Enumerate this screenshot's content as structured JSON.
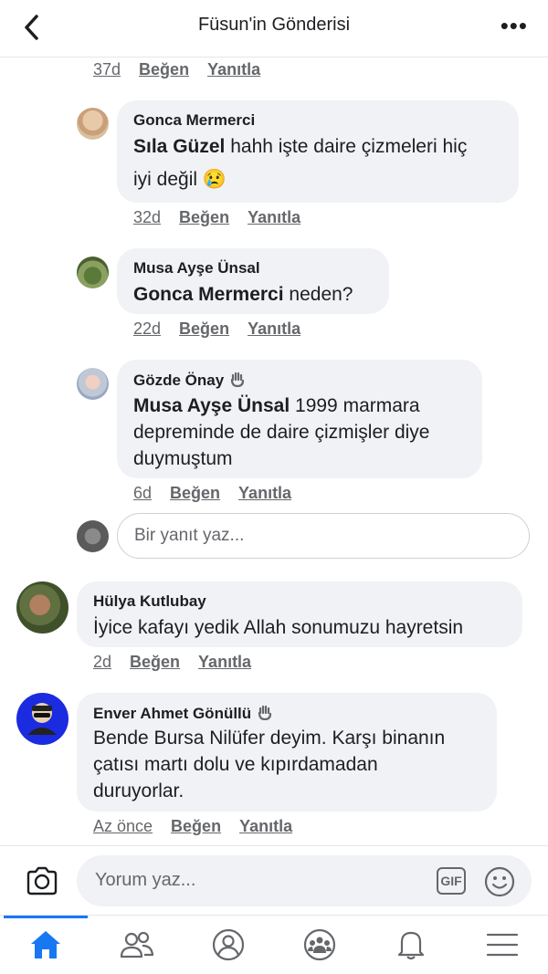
{
  "header": {
    "title": "Füsun'in Gönderisi"
  },
  "top_meta": {
    "time": "37d",
    "like": "Beğen",
    "reply": "Yanıtla"
  },
  "comments": [
    {
      "author": "Gonca Mermerci",
      "mention": "Sıla Güzel",
      "text": " hahh işte daire çizmeleri hiç",
      "text2": "iyi değil",
      "emoji": "😢",
      "time": "32d",
      "like": "Beğen",
      "reply": "Yanıtla"
    },
    {
      "author": "Musa Ayşe Ünsal",
      "mention": "Gonca Mermerci",
      "text": " neden?",
      "time": "22d",
      "like": "Beğen",
      "reply": "Yanıtla"
    },
    {
      "author": "Gözde Önay",
      "mention": "Musa Ayşe Ünsal",
      "text": " 1999 marmara",
      "text2": "depreminde de daire çizmişler diye",
      "text3": "duymuştum",
      "time": "6d",
      "like": "Beğen",
      "reply": "Yanıtla"
    },
    {
      "author": "Hülya Kutlubay",
      "text": "İyice kafayı yedik Allah sonumuzu hayretsin",
      "time": "2d",
      "like": "Beğen",
      "reply": "Yanıtla"
    },
    {
      "author": "Enver Ahmet Gönüllü",
      "text": "Bende Bursa Nilüfer deyim. Karşı binanın",
      "text2": "çatısı martı dolu ve kıpırdamadan",
      "text3": "duruyorlar.",
      "time": "Az önce",
      "like": "Beğen",
      "reply": "Yanıtla"
    }
  ],
  "reply_input": {
    "placeholder": "Bir yanıt yaz..."
  },
  "composer": {
    "placeholder": "Yorum yaz...",
    "gif": "GIF"
  },
  "colors": {
    "accent": "#1877f2",
    "bubble": "#f0f2f5",
    "meta": "#65676b"
  },
  "tabs": [
    "home-icon",
    "friends-icon",
    "profile-icon",
    "groups-icon",
    "notifications-icon",
    "menu-icon"
  ]
}
